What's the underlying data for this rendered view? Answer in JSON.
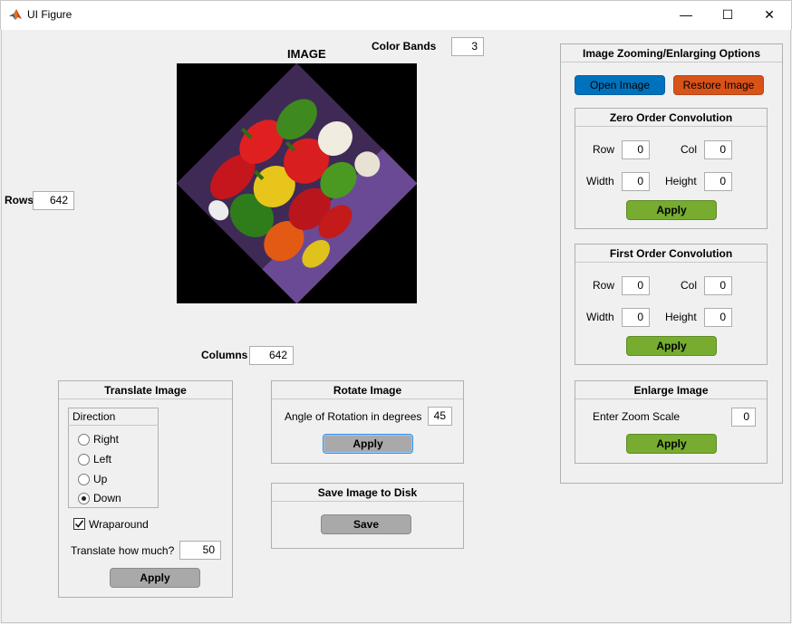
{
  "window": {
    "title": "UI Figure",
    "minimize_icon": "minimize-icon",
    "maximize_icon": "maximize-icon",
    "close_icon": "close-icon",
    "minimize_glyph": "—",
    "maximize_glyph": "☐",
    "close_glyph": "✕"
  },
  "image_area": {
    "title": "IMAGE",
    "color_bands_label": "Color Bands",
    "color_bands_value": "3",
    "rows_label": "Rows",
    "rows_value": "642",
    "columns_label": "Columns",
    "columns_value": "642",
    "rotation_degrees": 45
  },
  "translate": {
    "title": "Translate Image",
    "direction_title": "Direction",
    "options": [
      "Right",
      "Left",
      "Up",
      "Down"
    ],
    "selected": "Down",
    "wraparound_label": "Wraparound",
    "wraparound_checked": true,
    "amount_label": "Translate how much?",
    "amount_value": "50",
    "apply_label": "Apply"
  },
  "rotate": {
    "title": "Rotate Image",
    "angle_label": "Angle of Rotation in degrees",
    "angle_value": "45",
    "apply_label": "Apply"
  },
  "save": {
    "title": "Save Image to Disk",
    "save_label": "Save"
  },
  "zoom": {
    "title": "Image Zooming/Enlarging Options",
    "open_label": "Open Image",
    "restore_label": "Restore Image",
    "zero_order": {
      "title": "Zero Order Convolution",
      "row_label": "Row",
      "row_value": "0",
      "col_label": "Col",
      "col_value": "0",
      "width_label": "Width",
      "width_value": "0",
      "height_label": "Height",
      "height_value": "0",
      "apply_label": "Apply"
    },
    "first_order": {
      "title": "First Order Convolution",
      "row_label": "Row",
      "row_value": "0",
      "col_label": "Col",
      "col_value": "0",
      "width_label": "Width",
      "width_value": "0",
      "height_label": "Height",
      "height_value": "0",
      "apply_label": "Apply"
    },
    "enlarge": {
      "title": "Enlarge Image",
      "scale_label": "Enter Zoom Scale",
      "scale_value": "0",
      "apply_label": "Apply"
    }
  },
  "colors": {
    "green_button": "#77ac30",
    "blue_button": "#0072bd",
    "orange_button": "#d95319",
    "gray_button": "#a9a9a9"
  }
}
